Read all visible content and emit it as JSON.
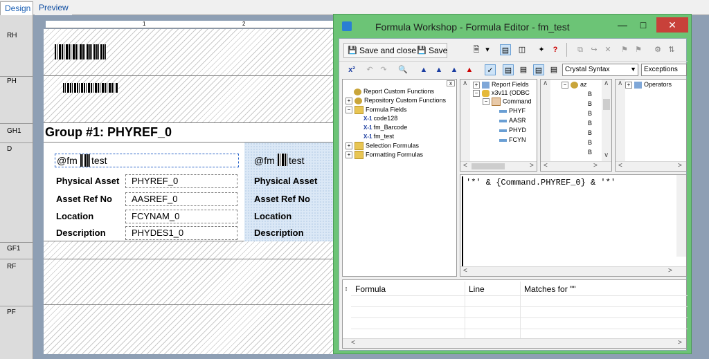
{
  "tabs": [
    {
      "label": "Design"
    },
    {
      "label": "Preview"
    }
  ],
  "sections": {
    "rh": "RH",
    "ph": "PH",
    "gh1": "GH1",
    "d": "D",
    "gf1": "GF1",
    "rf": "RF",
    "pf": "PF"
  },
  "ruler": {
    "n1": "1",
    "n2": "2"
  },
  "report": {
    "group_title": "Group #1: PHYREF_0",
    "formula_field": "@fm",
    "formula_field_suffix": "test",
    "labels": {
      "asset": "Physical Asset",
      "ref": "Asset Ref No",
      "location": "Location",
      "description": "Description"
    },
    "values": {
      "asset": "PHYREF_0",
      "ref": "AASREF_0",
      "location": "FCYNAM_0",
      "description": "PHYDES1_0"
    }
  },
  "formula_window": {
    "title": "Formula Workshop - Formula Editor - fm_test",
    "save_close": "Save and close",
    "save": "Save",
    "syntax_select": "Crystal Syntax",
    "exceptions_select": "Exceptions",
    "tree": {
      "report_custom": "Report Custom Functions",
      "repo_custom": "Repository Custom Functions",
      "formula_fields": "Formula Fields",
      "code128": "code128",
      "fm_barcode": "fm_Barcode",
      "fm_test": "fm_test",
      "selection": "Selection Formulas",
      "formatting": "Formatting Formulas"
    },
    "fields_tree": {
      "report_fields": "Report Fields",
      "x3v11": "x3v11 (ODBC",
      "command": "Command",
      "f1": "PHYF",
      "f2": "AASR",
      "f3": "PHYD",
      "f4": "FCYN"
    },
    "functions_tree": {
      "root": "az",
      "items": [
        "B",
        "B",
        "B",
        "B",
        "B",
        "B",
        "B",
        "B"
      ]
    },
    "operators_tree": {
      "root": "Operators"
    },
    "formula_text": "'*' & {Command.PHYREF_0} & '*'",
    "grid": {
      "col1": "Formula",
      "col2": "Line",
      "col3": "Matches for \"\""
    }
  },
  "colors": {
    "accent_green": "#6cc476",
    "close_red": "#c8413a",
    "designer_bg": "#8e9fb4"
  }
}
